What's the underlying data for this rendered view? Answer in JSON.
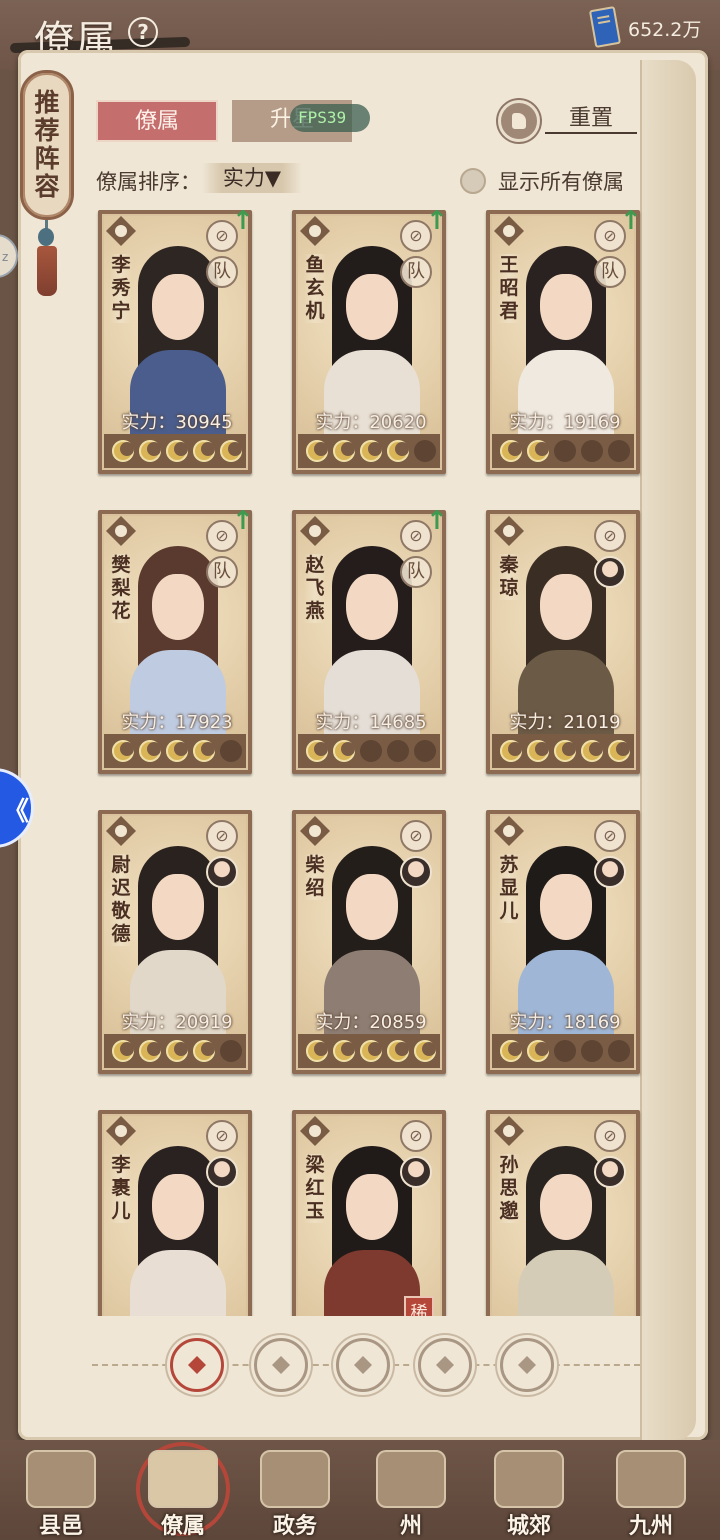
{
  "header": {
    "title": "僚属",
    "currency": "652.2万"
  },
  "recommend_label": "推荐阵容",
  "tabs": [
    {
      "label": "僚属",
      "active": true
    },
    {
      "label": "升星",
      "active": false
    }
  ],
  "fps": "FPS39",
  "reset_label": "重置",
  "sort": {
    "label": "僚属排序：",
    "value": "实力▼"
  },
  "show_all_label": "显示所有僚属",
  "power_prefix": "实力：",
  "cards": [
    {
      "name": "李秀宁",
      "power": "30945",
      "moons": 5,
      "team": "队",
      "upgrade": true
    },
    {
      "name": "鱼玄机",
      "power": "20620",
      "moons": 4,
      "team": "队",
      "upgrade": true
    },
    {
      "name": "王昭君",
      "power": "19169",
      "moons": 2,
      "team": "队",
      "upgrade": true
    },
    {
      "name": "樊梨花",
      "power": "17923",
      "moons": 4,
      "team": "队",
      "upgrade": true
    },
    {
      "name": "赵飞燕",
      "power": "14685",
      "moons": 2,
      "team": "队",
      "upgrade": true
    },
    {
      "name": "秦琼",
      "power": "21019",
      "moons": 5,
      "team": "",
      "upgrade": false
    },
    {
      "name": "尉迟敬德",
      "power": "20919",
      "moons": 4,
      "team": "",
      "upgrade": false
    },
    {
      "name": "柴绍",
      "power": "20859",
      "moons": 5,
      "team": "",
      "upgrade": false
    },
    {
      "name": "苏显儿",
      "power": "18169",
      "moons": 2,
      "team": "",
      "upgrade": false
    },
    {
      "name": "李裹儿",
      "power": "",
      "moons": 0,
      "team": "",
      "upgrade": false
    },
    {
      "name": "梁红玉",
      "power": "",
      "moons": 0,
      "team": "",
      "upgrade": false,
      "rare": "稀有"
    },
    {
      "name": "孙思邈",
      "power": "",
      "moons": 0,
      "team": "",
      "upgrade": false
    }
  ],
  "nav": [
    {
      "label": "县邑",
      "active": false
    },
    {
      "label": "僚属",
      "active": true
    },
    {
      "label": "政务",
      "active": false
    },
    {
      "label": "州",
      "active": false
    },
    {
      "label": "城郊",
      "active": false
    },
    {
      "label": "九州",
      "active": false
    }
  ]
}
